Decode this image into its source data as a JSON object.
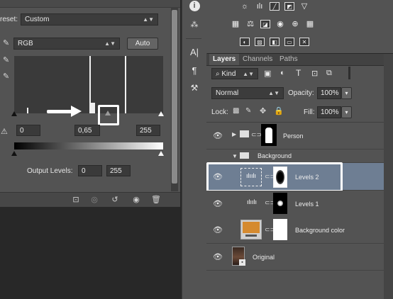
{
  "properties": {
    "preset_label": "reset:",
    "preset_value": "Custom",
    "channel_value": "RGB",
    "auto_label": "Auto",
    "input_black": "0",
    "input_mid": "0,65",
    "input_white": "255",
    "output_label": "Output Levels:",
    "output_black": "0",
    "output_white": "255"
  },
  "layers_panel": {
    "tabs": [
      "Layers",
      "Channels",
      "Paths"
    ],
    "kind_label": "Kind",
    "blend_mode": "Normal",
    "opacity_label": "Opacity:",
    "opacity_value": "100%",
    "lock_label": "Lock:",
    "fill_label": "Fill:",
    "fill_value": "100%",
    "layers": [
      {
        "name": "Person"
      },
      {
        "name": "Background"
      },
      {
        "name": "Levels 2"
      },
      {
        "name": "Levels 1"
      },
      {
        "name": "Background color"
      },
      {
        "name": "Original"
      }
    ]
  },
  "colors": {
    "panel": "#535353",
    "selected_layer": "#6e7e93",
    "background_color_swatch": "#d58a2f",
    "annotation": "#ffffff"
  },
  "icons": {
    "info": "info-icon",
    "eyedropper": "eyedropper-icon",
    "eye": "eye-icon"
  }
}
